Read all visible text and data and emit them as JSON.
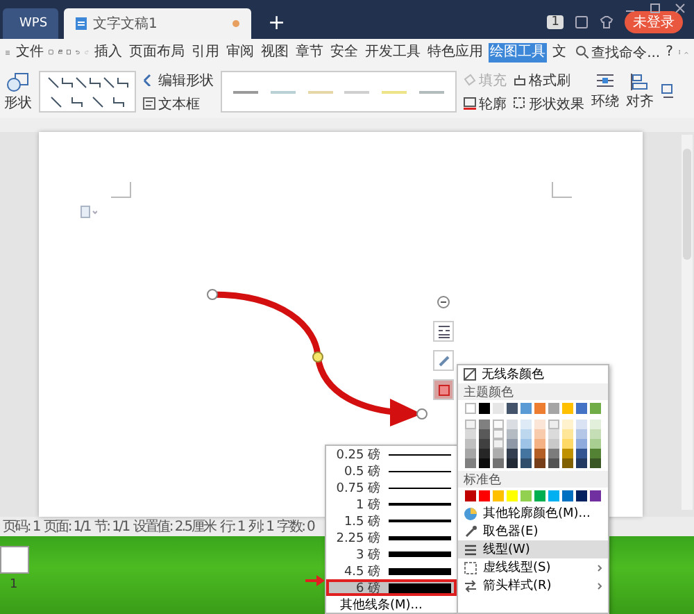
{
  "title_bar": {
    "tabs": [
      {
        "kind": "app",
        "label": "WPS",
        "selected": false
      },
      {
        "kind": "doc",
        "label": "文字文稿1",
        "selected": true
      }
    ],
    "new_tab": "+",
    "badge": "1",
    "login_button": "未登录"
  },
  "menu_bar": {
    "file_menu": "文件",
    "tabs": [
      {
        "label": "插入",
        "selected": false
      },
      {
        "label": "页面布局",
        "selected": false
      },
      {
        "label": "引用",
        "selected": false
      },
      {
        "label": "审阅",
        "selected": false
      },
      {
        "label": "视图",
        "selected": false
      },
      {
        "label": "章节",
        "selected": false
      },
      {
        "label": "安全",
        "selected": false
      },
      {
        "label": "开发工具",
        "selected": false
      },
      {
        "label": "特色应用",
        "selected": false
      },
      {
        "label": "绘图工具",
        "selected": true
      },
      {
        "label": "文",
        "selected": false
      }
    ],
    "search": "查找命令...",
    "help": "?"
  },
  "ribbon": {
    "shape_button": "形状",
    "edit_shape": "编辑形状",
    "text_box": "文本框",
    "line_styles": [
      {
        "color": "#9a9a9a"
      },
      {
        "color": "#b9d0d6"
      },
      {
        "color": "#e6d7a9"
      },
      {
        "color": "#cfcfcf"
      },
      {
        "color": "#ede48a"
      },
      {
        "color": "#b3bcbc"
      }
    ],
    "fill": {
      "label": "填充",
      "disabled": true
    },
    "format_painter": "格式刷",
    "outline": "轮廓",
    "shape_effects": "形状效果",
    "wrap": "环绕",
    "align": "对齐"
  },
  "float_toolbar": [
    {
      "kind": "collapse",
      "selected": false
    },
    {
      "kind": "layout",
      "selected": false
    },
    {
      "kind": "pen",
      "selected": false
    },
    {
      "kind": "outline",
      "selected": true
    }
  ],
  "status_bar": {
    "items": [
      "页码: 1",
      "页面: 1/1",
      "节: 1/1",
      "设置值: 2.5厘米",
      "行: 1",
      "列: 1",
      "字数: 0"
    ]
  },
  "line_weight_menu": {
    "items": [
      {
        "label": "0.25 磅",
        "selected": false
      },
      {
        "label": "0.5 磅",
        "selected": false
      },
      {
        "label": "0.75 磅",
        "selected": false
      },
      {
        "label": "1 磅",
        "selected": false
      },
      {
        "label": "1.5 磅",
        "selected": false
      },
      {
        "label": "2.25 磅",
        "selected": false
      },
      {
        "label": "3 磅",
        "selected": false
      },
      {
        "label": "4.5 磅",
        "selected": false
      },
      {
        "label": "6 磅",
        "selected": true
      }
    ],
    "more": "其他线条(M)..."
  },
  "outline_menu": {
    "no_color": "无线条颜色",
    "theme_title": "主题颜色",
    "theme_colors": [
      {
        "color": "#ffffff"
      },
      {
        "color": "#000000"
      },
      {
        "color": "#e7e6e6"
      },
      {
        "color": "#44546a"
      },
      {
        "color": "#5b9bd5"
      },
      {
        "color": "#ed7d31"
      },
      {
        "color": "#a5a5a5"
      },
      {
        "color": "#ffc000"
      },
      {
        "color": "#4472c4"
      },
      {
        "color": "#70ad47"
      }
    ],
    "standard_title": "标准色",
    "standard_colors": [
      {
        "color": "#c00000"
      },
      {
        "color": "#ff0000"
      },
      {
        "color": "#ffc000"
      },
      {
        "color": "#ffff00"
      },
      {
        "color": "#92d050"
      },
      {
        "color": "#00b050"
      },
      {
        "color": "#00b0f0"
      },
      {
        "color": "#0070c0"
      },
      {
        "color": "#002060"
      },
      {
        "color": "#7030a0"
      }
    ],
    "items": [
      {
        "kind": "more_colors",
        "label": "其他轮廓颜色(M)...",
        "selected": false,
        "submenu": false
      },
      {
        "kind": "eyedropper",
        "label": "取色器(E)",
        "selected": false,
        "submenu": false
      },
      {
        "kind": "weight",
        "label": "线型(W)",
        "selected": true,
        "submenu": false
      },
      {
        "kind": "dash",
        "label": "虚线线型(S)",
        "selected": false,
        "submenu": true
      },
      {
        "kind": "arrow",
        "label": "箭头样式(R)",
        "selected": false,
        "submenu": true
      }
    ]
  },
  "desktop": {
    "icon_label": "1"
  }
}
